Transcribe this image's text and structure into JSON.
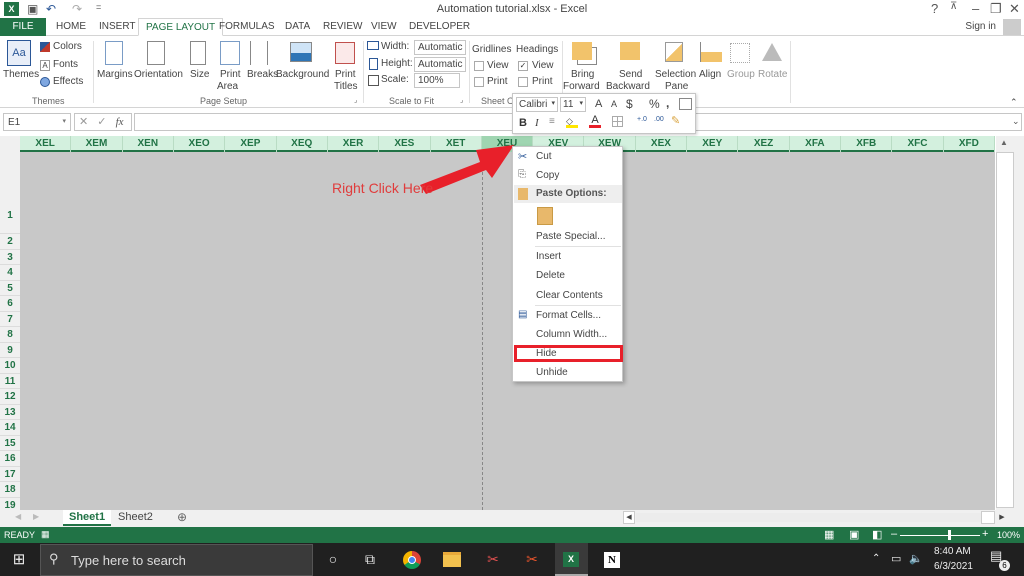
{
  "window": {
    "title": "Automation tutorial.xlsx - Excel",
    "controls": [
      "?",
      "ribbon-display",
      "minimize",
      "restore",
      "close"
    ]
  },
  "qat": {
    "save": "💾",
    "undo": "↶",
    "redo": "↷",
    "customize": "="
  },
  "tabs": [
    "FILE",
    "HOME",
    "INSERT",
    "PAGE LAYOUT",
    "FORMULAS",
    "DATA",
    "REVIEW",
    "VIEW",
    "DEVELOPER"
  ],
  "active_tab": "PAGE LAYOUT",
  "account": {
    "sign_in": "Sign in"
  },
  "ribbon": {
    "themes": {
      "themes": "Themes",
      "colors": "Colors",
      "fonts": "Fonts",
      "effects": "Effects",
      "group": "Themes"
    },
    "page_setup": {
      "margins": "Margins",
      "orientation": "Orientation",
      "size": "Size",
      "print_area_1": "Print",
      "print_area_2": "Area",
      "breaks": "Breaks",
      "background": "Background",
      "print_titles_1": "Print",
      "print_titles_2": "Titles",
      "group": "Page Setup"
    },
    "scale_to_fit": {
      "width_label": "Width:",
      "width_value": "Automatic",
      "height_label": "Height:",
      "height_value": "Automatic",
      "scale_label": "Scale:",
      "scale_value": "100%",
      "group": "Scale to Fit"
    },
    "sheet_options": {
      "gridlines": "Gridlines",
      "headings": "Headings",
      "view": "View",
      "print": "Print",
      "group": "Sheet Op",
      "gridlines_view": false,
      "gridlines_print": false,
      "headings_view": true,
      "headings_print": false
    },
    "arrange": {
      "bring_1": "Bring",
      "bring_2": "Forward",
      "send_1": "Send",
      "send_2": "Backward",
      "selection_1": "Selection",
      "selection_2": "Pane",
      "align": "Align",
      "group_btn": "Group",
      "rotate": "Rotate"
    }
  },
  "formula_bar": {
    "name_box": "E1",
    "cancel": "✕",
    "enter": "✓",
    "fx": "fx",
    "value": ""
  },
  "columns": [
    "XEL",
    "XEM",
    "XEN",
    "XEO",
    "XEP",
    "XEQ",
    "XER",
    "XES",
    "XET",
    "XEU",
    "XEV",
    "XEW",
    "XEX",
    "XEY",
    "XEZ",
    "XFA",
    "XFB",
    "XFC",
    "XFD"
  ],
  "selected_column": "XEU",
  "rows": [
    "1",
    "2",
    "3",
    "4",
    "5",
    "6",
    "7",
    "8",
    "9",
    "10",
    "11",
    "12",
    "13",
    "14",
    "15",
    "16",
    "17",
    "18",
    "19"
  ],
  "annotation": {
    "text": "Right Click Here",
    "color": "#e03c3c"
  },
  "mini_toolbar": {
    "font": "Calibri",
    "size": "11",
    "grow": "A",
    "shrink": "A",
    "currency": "$",
    "percent": "%",
    "comma": ",",
    "bold": "B",
    "italic": "I"
  },
  "context_menu": {
    "items": [
      {
        "label": "Cut",
        "icon": "scissors-icon"
      },
      {
        "label": "Copy",
        "icon": "copy-icon"
      },
      {
        "label": "Paste Options:",
        "header": true
      },
      {
        "label": "Paste Special..."
      },
      {
        "label": "Insert"
      },
      {
        "label": "Delete"
      },
      {
        "label": "Clear Contents"
      },
      {
        "label": "Format Cells...",
        "icon": "format-cells-icon"
      },
      {
        "label": "Column Width..."
      },
      {
        "label": "Hide",
        "highlighted": true
      },
      {
        "label": "Unhide"
      }
    ]
  },
  "sheets": [
    "Sheet1",
    "Sheet2"
  ],
  "active_sheet": "Sheet1",
  "status": {
    "mode": "READY",
    "zoom": "100%",
    "zoom_fraction": 0.5
  },
  "taskbar": {
    "search_placeholder": "Type here to search",
    "time": "8:40 AM",
    "date": "6/3/2021",
    "notifications": "6"
  },
  "colors": {
    "excel_green": "#217346",
    "header_green": "#d3f0de",
    "highlight_red": "#e8202a"
  }
}
